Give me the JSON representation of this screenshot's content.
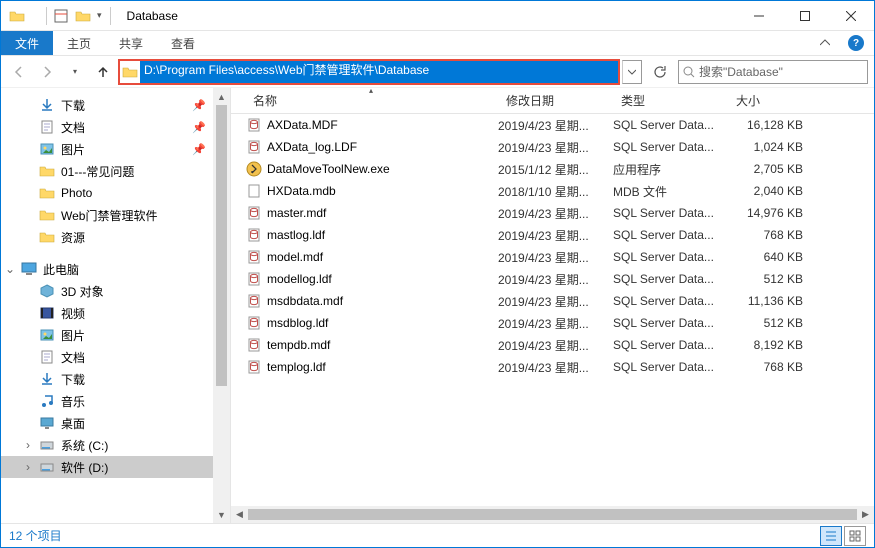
{
  "window": {
    "title": "Database"
  },
  "ribbon": {
    "file": "文件",
    "tabs": [
      "主页",
      "共享",
      "查看"
    ]
  },
  "nav": {
    "back_enabled": false,
    "fwd_enabled": false,
    "up_enabled": true,
    "path": "D:\\Program Files\\access\\Web门禁管理软件\\Database",
    "search_placeholder": "搜索\"Database\""
  },
  "tree": {
    "quick": [
      {
        "label": "下载",
        "icon": "download",
        "pinned": true
      },
      {
        "label": "文档",
        "icon": "document",
        "pinned": true
      },
      {
        "label": "图片",
        "icon": "picture",
        "pinned": true
      },
      {
        "label": "01---常见问题",
        "icon": "folder"
      },
      {
        "label": "Photo",
        "icon": "folder"
      },
      {
        "label": "Web门禁管理软件",
        "icon": "folder"
      },
      {
        "label": "资源",
        "icon": "folder"
      }
    ],
    "pc_label": "此电脑",
    "pc": [
      {
        "label": "3D 对象",
        "icon": "3d"
      },
      {
        "label": "视频",
        "icon": "video"
      },
      {
        "label": "图片",
        "icon": "picture"
      },
      {
        "label": "文档",
        "icon": "document"
      },
      {
        "label": "下载",
        "icon": "download"
      },
      {
        "label": "音乐",
        "icon": "music"
      },
      {
        "label": "桌面",
        "icon": "desktop"
      },
      {
        "label": "系统 (C:)",
        "icon": "drive",
        "expandable": true
      },
      {
        "label": "软件 (D:)",
        "icon": "drive",
        "expandable": true,
        "selected": true
      }
    ]
  },
  "columns": {
    "name": "名称",
    "date": "修改日期",
    "type": "类型",
    "size": "大小"
  },
  "files": [
    {
      "name": "AXData.MDF",
      "date": "2019/4/23 星期...",
      "type": "SQL Server Data...",
      "size": "16,128 KB",
      "icon": "db"
    },
    {
      "name": "AXData_log.LDF",
      "date": "2019/4/23 星期...",
      "type": "SQL Server Data...",
      "size": "1,024 KB",
      "icon": "db"
    },
    {
      "name": "DataMoveToolNew.exe",
      "date": "2015/1/12 星期...",
      "type": "应用程序",
      "size": "2,705 KB",
      "icon": "exe"
    },
    {
      "name": "HXData.mdb",
      "date": "2018/1/10 星期...",
      "type": "MDB 文件",
      "size": "2,040 KB",
      "icon": "file"
    },
    {
      "name": "master.mdf",
      "date": "2019/4/23 星期...",
      "type": "SQL Server Data...",
      "size": "14,976 KB",
      "icon": "db"
    },
    {
      "name": "mastlog.ldf",
      "date": "2019/4/23 星期...",
      "type": "SQL Server Data...",
      "size": "768 KB",
      "icon": "db"
    },
    {
      "name": "model.mdf",
      "date": "2019/4/23 星期...",
      "type": "SQL Server Data...",
      "size": "640 KB",
      "icon": "db"
    },
    {
      "name": "modellog.ldf",
      "date": "2019/4/23 星期...",
      "type": "SQL Server Data...",
      "size": "512 KB",
      "icon": "db"
    },
    {
      "name": "msdbdata.mdf",
      "date": "2019/4/23 星期...",
      "type": "SQL Server Data...",
      "size": "11,136 KB",
      "icon": "db"
    },
    {
      "name": "msdblog.ldf",
      "date": "2019/4/23 星期...",
      "type": "SQL Server Data...",
      "size": "512 KB",
      "icon": "db"
    },
    {
      "name": "tempdb.mdf",
      "date": "2019/4/23 星期...",
      "type": "SQL Server Data...",
      "size": "8,192 KB",
      "icon": "db"
    },
    {
      "name": "templog.ldf",
      "date": "2019/4/23 星期...",
      "type": "SQL Server Data...",
      "size": "768 KB",
      "icon": "db"
    }
  ],
  "status": {
    "count_label": "12 个项目"
  }
}
